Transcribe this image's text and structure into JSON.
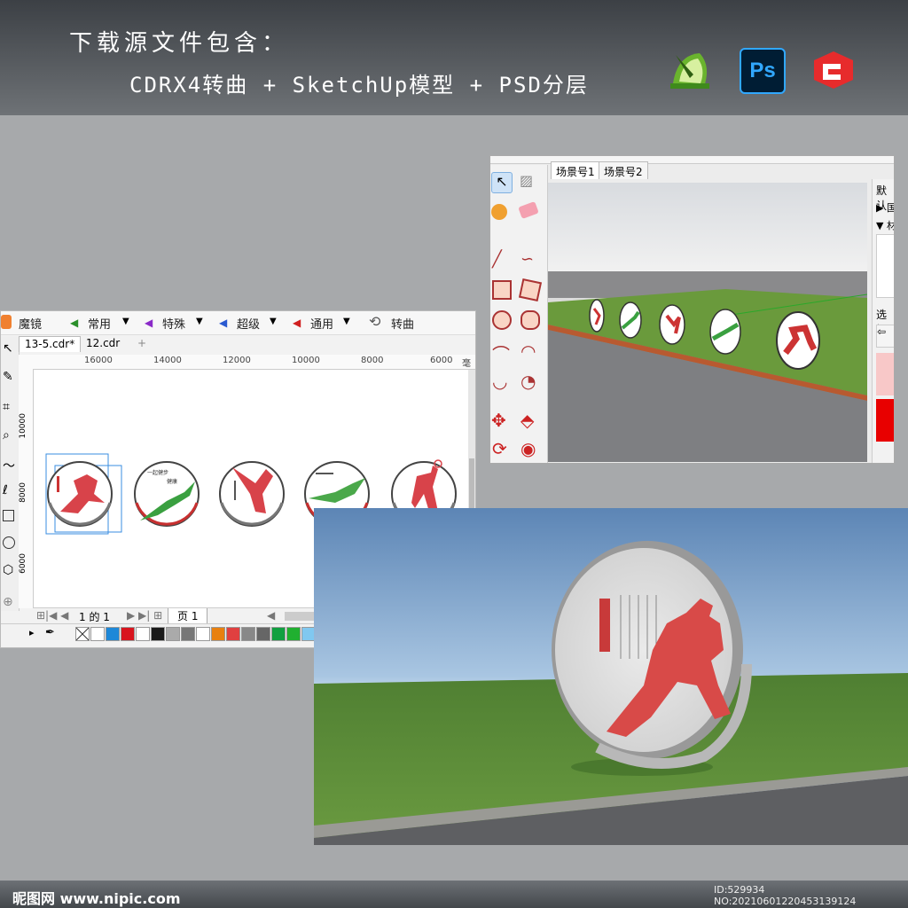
{
  "header": {
    "line1": "下载源文件包含：",
    "line2": "CDRX4转曲 + SketchUp模型 + PSD分层",
    "apps": [
      {
        "name": "coreldraw",
        "color": "#6ab42d"
      },
      {
        "name": "photoshop",
        "label": "Ps",
        "color": "#001d34",
        "accent": "#31a8ff"
      },
      {
        "name": "sketchup",
        "color": "#e72b2c"
      }
    ]
  },
  "coreldraw": {
    "menu": [
      "魔镜",
      "常用",
      "特殊",
      "超级",
      "通用",
      "转曲"
    ],
    "tabs": [
      "13-5.cdr*",
      "12.cdr",
      "+"
    ],
    "ruler": [
      "16000",
      "14000",
      "12000",
      "10000",
      "8000",
      "6000",
      "毫"
    ],
    "vruler": [
      "10000",
      "8000",
      "6000"
    ],
    "pager": {
      "counter": "1 的 1",
      "page": "页 1"
    },
    "figure_text": [
      "一起健步",
      "健康"
    ],
    "palette": [
      "#ffffff",
      "#1e88d8",
      "#d8141e",
      "#ffffff",
      "#1a1a1a",
      "#aaaaaa",
      "#777777",
      "#ffffff",
      "#e88010",
      "#e04040",
      "#888888",
      "#666666",
      "#10a040",
      "#20b030",
      "#80c8f0",
      "#40a020",
      "#e09010",
      "#f8d000",
      "#88c8f0",
      "#3080d0",
      "#000000",
      "#e8e8e8"
    ]
  },
  "sketchup": {
    "tabs": [
      "场景号1",
      "场景号2"
    ],
    "panel_items": [
      "默认",
      "▶ 国",
      "▼ 材",
      "选择"
    ]
  },
  "footer": {
    "logo": "昵图网 www.nipic.com",
    "id": "ID:529934 NO:20210601220453139124"
  }
}
